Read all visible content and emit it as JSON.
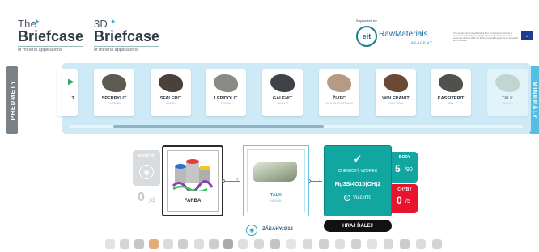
{
  "header": {
    "logo1": {
      "the": "The",
      "title": "Briefcase",
      "sub": "of mineral applications"
    },
    "logo2": {
      "the": "3D",
      "title": "Briefcase",
      "sub": "of mineral applications"
    },
    "supported_by": "Supported by",
    "eit": "eit",
    "rawmaterials": "RawMaterials",
    "academy": "ACADEMY",
    "eu_text": "This activity has received funding from the European Institute of Innovation and Technology (EIT), a body of the European Union, under the Horizon 2020, the EU Framework Programme for Research and Innovation"
  },
  "side_tabs": {
    "left": "PREDMETY",
    "right": "MINERÁLY"
  },
  "minerals": [
    {
      "name": "T",
      "sub": "",
      "color": "#8a8f86"
    },
    {
      "name": "SPERRYLIT",
      "sub": "PLATINA",
      "color": "#5d5a52"
    },
    {
      "name": "SFALERIT",
      "sub": "ZINOK",
      "color": "#4a423a"
    },
    {
      "name": "LEPIDOLIT",
      "sub": "LÍTIUM",
      "color": "#8a8a84"
    },
    {
      "name": "GALENIT",
      "sub": "OLOVO",
      "color": "#3f4347"
    },
    {
      "name": "ŽIVEC",
      "sub": "PLNIVÁ A KERAMIK",
      "color": "#b59a86"
    },
    {
      "name": "WOLFRAMIT",
      "sub": "VOLFRÁM",
      "color": "#6a4a35"
    },
    {
      "name": "KASSITERIT",
      "sub": "CÍN",
      "color": "#50504c"
    },
    {
      "name": "TALK",
      "sub": "HENOK",
      "color": "#b3bfa6"
    }
  ],
  "game": {
    "indicie_label": "INDÍCIE",
    "indicie_count": "0",
    "indicie_total": "/4",
    "product_label": "FARBA",
    "mineral_label": "TALK",
    "mineral_sub": "HENOK",
    "formula_label": "CHEMICKÝ VZOREC",
    "formula_value": "Mg3Si4O10(OH)2",
    "more_info": "Viac info",
    "points_label": "BODY",
    "points_value": "5",
    "points_total": "/90",
    "errors_label": "CHYBY",
    "errors_value": "0",
    "errors_total": "/5",
    "play_next": "HRAJ ĎALEJ",
    "hits_label": "ZÁSAHY:1/18"
  },
  "colors": {
    "teal": "#11a6a0",
    "red": "#e8142e",
    "panel": "#cdeaf6",
    "accent": "#54bfe0"
  }
}
